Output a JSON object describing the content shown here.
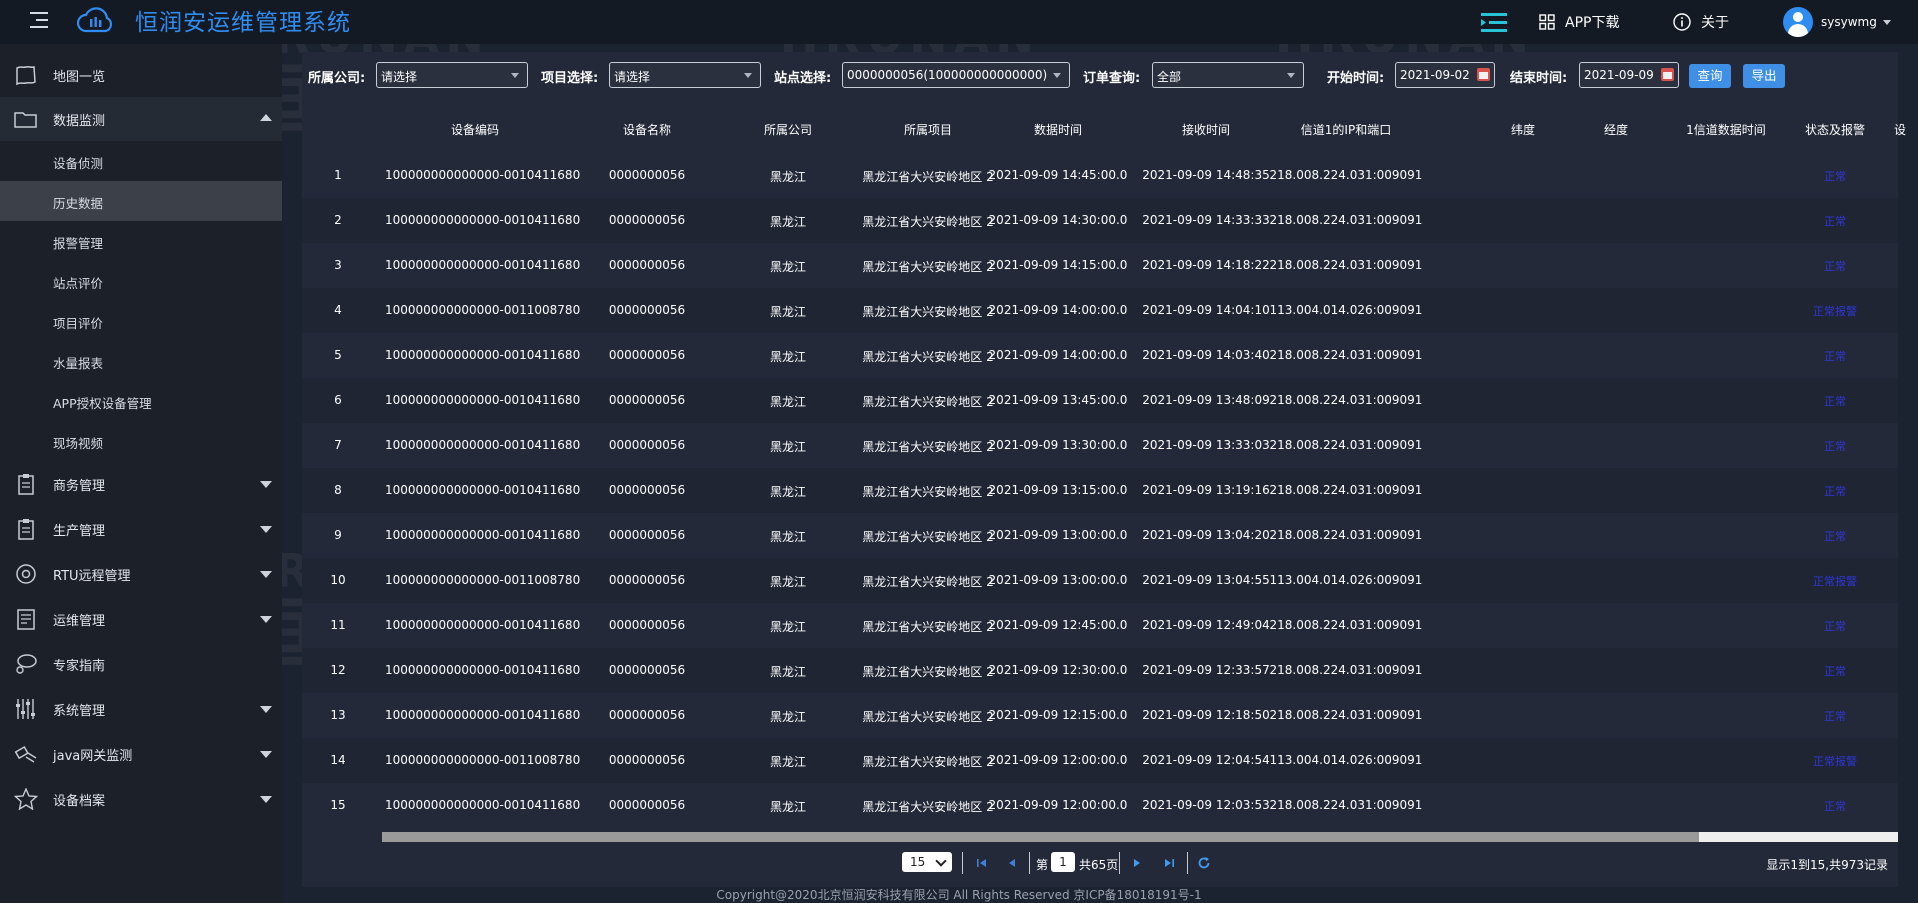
{
  "app": {
    "title": "恒润安运维管理系统"
  },
  "header": {
    "app_download": "APP下载",
    "about": "关于",
    "username": "sysywmg"
  },
  "watermark": {
    "en": "HRUNAN",
    "cn": "恒润安"
  },
  "sidebar": {
    "items": [
      {
        "label": "地图一览",
        "icon": "map-icon"
      },
      {
        "label": "数据监测",
        "icon": "folder-icon"
      },
      {
        "label": "商务管理",
        "icon": "clipboard-icon"
      },
      {
        "label": "生产管理",
        "icon": "clipboard-icon"
      },
      {
        "label": "RTU远程管理",
        "icon": "target-icon"
      },
      {
        "label": "运维管理",
        "icon": "document-icon"
      },
      {
        "label": "专家指南",
        "icon": "chat-user-icon"
      },
      {
        "label": "系统管理",
        "icon": "sliders-icon"
      },
      {
        "label": "java网关监测",
        "icon": "satellite-icon"
      },
      {
        "label": "设备档案",
        "icon": "star-icon"
      }
    ],
    "sub_items": [
      {
        "label": "设备侦测"
      },
      {
        "label": "历史数据"
      },
      {
        "label": "报警管理"
      },
      {
        "label": "站点评价"
      },
      {
        "label": "项目评价"
      },
      {
        "label": "水量报表"
      },
      {
        "label": "APP授权设备管理"
      },
      {
        "label": "现场视频"
      }
    ]
  },
  "filters": {
    "company_label": "所属公司:",
    "company_value": "请选择",
    "project_label": "项目选择:",
    "project_value": "请选择",
    "station_label": "站点选择:",
    "station_value": "0000000056(100000000000000)",
    "order_label": "订单查询:",
    "order_value": "全部",
    "start_label": "开始时间:",
    "start_value": "2021-09-02",
    "end_label": "结束时间:",
    "end_value": "2021-09-09",
    "query_button": "查询",
    "export_button": "导出"
  },
  "table": {
    "columns": [
      "设备编码",
      "设备名称",
      "所属公司",
      "所属项目",
      "数据时间",
      "接收时间",
      "信道1的IP和端口",
      "纬度",
      "经度",
      "1信道数据时间",
      "状态及报警",
      "设"
    ],
    "rows": [
      {
        "no": "1",
        "code": "100000000000000-0010411680",
        "name": "0000000056",
        "company": "黑龙江",
        "project": "黑龙江省大兴安岭地区 2",
        "data_time": "2021-09-09 14:45:00.0",
        "recv_time": "2021-09-09 14:48:35",
        "ip": "218.008.224.031:009091",
        "status": "正常"
      },
      {
        "no": "2",
        "code": "100000000000000-0010411680",
        "name": "0000000056",
        "company": "黑龙江",
        "project": "黑龙江省大兴安岭地区 2",
        "data_time": "2021-09-09 14:30:00.0",
        "recv_time": "2021-09-09 14:33:33",
        "ip": "218.008.224.031:009091",
        "status": "正常"
      },
      {
        "no": "3",
        "code": "100000000000000-0010411680",
        "name": "0000000056",
        "company": "黑龙江",
        "project": "黑龙江省大兴安岭地区 2",
        "data_time": "2021-09-09 14:15:00.0",
        "recv_time": "2021-09-09 14:18:22",
        "ip": "218.008.224.031:009091",
        "status": "正常"
      },
      {
        "no": "4",
        "code": "100000000000000-0011008780",
        "name": "0000000056",
        "company": "黑龙江",
        "project": "黑龙江省大兴安岭地区 2",
        "data_time": "2021-09-09 14:00:00.0",
        "recv_time": "2021-09-09 14:04:10",
        "ip": "113.004.014.026:009091",
        "status": "正常报警"
      },
      {
        "no": "5",
        "code": "100000000000000-0010411680",
        "name": "0000000056",
        "company": "黑龙江",
        "project": "黑龙江省大兴安岭地区 2",
        "data_time": "2021-09-09 14:00:00.0",
        "recv_time": "2021-09-09 14:03:40",
        "ip": "218.008.224.031:009091",
        "status": "正常"
      },
      {
        "no": "6",
        "code": "100000000000000-0010411680",
        "name": "0000000056",
        "company": "黑龙江",
        "project": "黑龙江省大兴安岭地区 2",
        "data_time": "2021-09-09 13:45:00.0",
        "recv_time": "2021-09-09 13:48:09",
        "ip": "218.008.224.031:009091",
        "status": "正常"
      },
      {
        "no": "7",
        "code": "100000000000000-0010411680",
        "name": "0000000056",
        "company": "黑龙江",
        "project": "黑龙江省大兴安岭地区 2",
        "data_time": "2021-09-09 13:30:00.0",
        "recv_time": "2021-09-09 13:33:03",
        "ip": "218.008.224.031:009091",
        "status": "正常"
      },
      {
        "no": "8",
        "code": "100000000000000-0010411680",
        "name": "0000000056",
        "company": "黑龙江",
        "project": "黑龙江省大兴安岭地区 2",
        "data_time": "2021-09-09 13:15:00.0",
        "recv_time": "2021-09-09 13:19:16",
        "ip": "218.008.224.031:009091",
        "status": "正常"
      },
      {
        "no": "9",
        "code": "100000000000000-0010411680",
        "name": "0000000056",
        "company": "黑龙江",
        "project": "黑龙江省大兴安岭地区 2",
        "data_time": "2021-09-09 13:00:00.0",
        "recv_time": "2021-09-09 13:04:20",
        "ip": "218.008.224.031:009091",
        "status": "正常"
      },
      {
        "no": "10",
        "code": "100000000000000-0011008780",
        "name": "0000000056",
        "company": "黑龙江",
        "project": "黑龙江省大兴安岭地区 2",
        "data_time": "2021-09-09 13:00:00.0",
        "recv_time": "2021-09-09 13:04:55",
        "ip": "113.004.014.026:009091",
        "status": "正常报警"
      },
      {
        "no": "11",
        "code": "100000000000000-0010411680",
        "name": "0000000056",
        "company": "黑龙江",
        "project": "黑龙江省大兴安岭地区 2",
        "data_time": "2021-09-09 12:45:00.0",
        "recv_time": "2021-09-09 12:49:04",
        "ip": "218.008.224.031:009091",
        "status": "正常"
      },
      {
        "no": "12",
        "code": "100000000000000-0010411680",
        "name": "0000000056",
        "company": "黑龙江",
        "project": "黑龙江省大兴安岭地区 2",
        "data_time": "2021-09-09 12:30:00.0",
        "recv_time": "2021-09-09 12:33:57",
        "ip": "218.008.224.031:009091",
        "status": "正常"
      },
      {
        "no": "13",
        "code": "100000000000000-0010411680",
        "name": "0000000056",
        "company": "黑龙江",
        "project": "黑龙江省大兴安岭地区 2",
        "data_time": "2021-09-09 12:15:00.0",
        "recv_time": "2021-09-09 12:18:50",
        "ip": "218.008.224.031:009091",
        "status": "正常"
      },
      {
        "no": "14",
        "code": "100000000000000-0011008780",
        "name": "0000000056",
        "company": "黑龙江",
        "project": "黑龙江省大兴安岭地区 2",
        "data_time": "2021-09-09 12:00:00.0",
        "recv_time": "2021-09-09 12:04:54",
        "ip": "113.004.014.026:009091",
        "status": "正常报警"
      },
      {
        "no": "15",
        "code": "100000000000000-0010411680",
        "name": "0000000056",
        "company": "黑龙江",
        "project": "黑龙江省大兴安岭地区 2",
        "data_time": "2021-09-09 12:00:00.0",
        "recv_time": "2021-09-09 12:03:53",
        "ip": "218.008.224.031:009091",
        "status": "正常"
      }
    ]
  },
  "pagination": {
    "page_size": "15",
    "page_prefix": "第",
    "current_page": "1",
    "total_pages_text": "共65页",
    "summary": "显示1到15,共973记录"
  },
  "footer": {
    "copyright": "Copyright@2020北京恒润安科技有限公司 All Rights Reserved 京ICP备18018191号-1"
  },
  "colors": {
    "accent": "#2f8cf0",
    "button": "#3e8fe5",
    "status_text": "#2f36d8"
  }
}
